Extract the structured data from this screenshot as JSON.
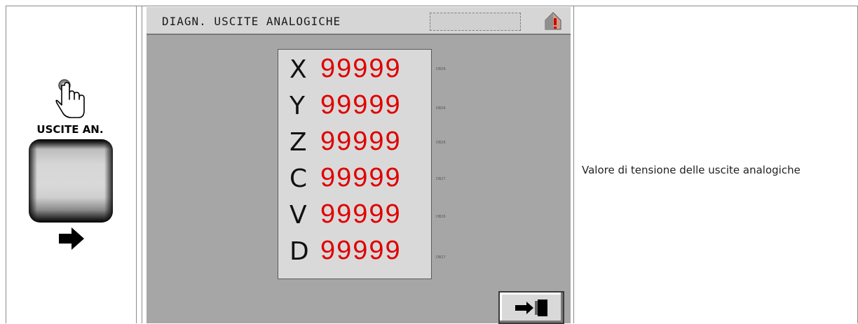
{
  "left": {
    "button_label": "USCITE AN.",
    "icons": {
      "pointer": "hand-pointer-icon",
      "next": "arrow-right-icon"
    }
  },
  "screen": {
    "title": "DIAGN. USCITE ANALOGICHE",
    "rows": [
      {
        "axis": "X",
        "value": "99999",
        "tag": "DB26"
      },
      {
        "axis": "Y",
        "value": "99999",
        "tag": "DB26"
      },
      {
        "axis": "Z",
        "value": "99999",
        "tag": "DB26"
      },
      {
        "axis": "C",
        "value": "99999",
        "tag": "DB27"
      },
      {
        "axis": "V",
        "value": "99999",
        "tag": "DB26"
      },
      {
        "axis": "D",
        "value": "99999",
        "tag": "DB27"
      }
    ],
    "icons": {
      "home": "home-alert-icon",
      "exit": "exit-door-icon"
    },
    "colors": {
      "value": "#e00000",
      "background": "#a6a6a6",
      "panel": "#d9d9d9"
    }
  },
  "right": {
    "description": "Valore di tensione delle uscite analogiche"
  }
}
